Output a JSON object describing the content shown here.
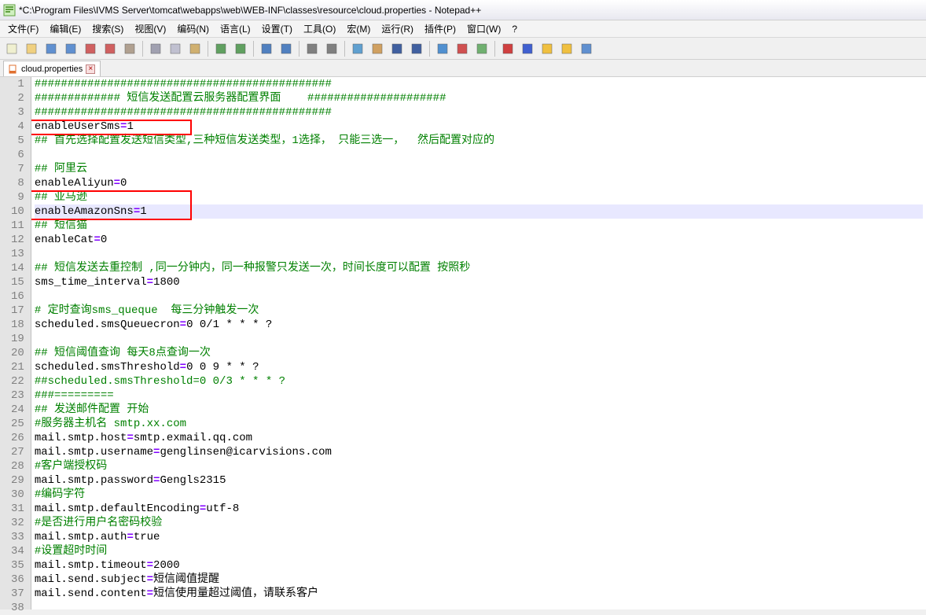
{
  "window": {
    "title": "*C:\\Program Files\\IVMS Server\\tomcat\\webapps\\web\\WEB-INF\\classes\\resource\\cloud.properties - Notepad++"
  },
  "menus": [
    {
      "label": "文件(F)"
    },
    {
      "label": "编辑(E)"
    },
    {
      "label": "搜索(S)"
    },
    {
      "label": "视图(V)"
    },
    {
      "label": "编码(N)"
    },
    {
      "label": "语言(L)"
    },
    {
      "label": "设置(T)"
    },
    {
      "label": "工具(O)"
    },
    {
      "label": "宏(M)"
    },
    {
      "label": "运行(R)"
    },
    {
      "label": "插件(P)"
    },
    {
      "label": "窗口(W)"
    },
    {
      "label": "?"
    }
  ],
  "tab": {
    "label": "cloud.properties",
    "close": "×"
  },
  "toolbar_icons": [
    "new-icon",
    "open-icon",
    "save-icon",
    "saveall-icon",
    "close-icon",
    "closeall-icon",
    "print-icon",
    "sep",
    "cut-icon",
    "copy-icon",
    "paste-icon",
    "sep",
    "undo-icon",
    "redo-icon",
    "sep",
    "find-icon",
    "replace-icon",
    "sep",
    "zoomin-icon",
    "zoomout-icon",
    "sep",
    "sync-icon",
    "wrap-icon",
    "allchars-icon",
    "indent-icon",
    "sep",
    "folder-icon",
    "lang-icon",
    "monitor-icon",
    "sep",
    "record-icon",
    "stoprec-icon",
    "play-icon",
    "playmulti-icon",
    "savemacro-icon"
  ],
  "lines": [
    {
      "n": 1,
      "t": "comment",
      "text": "#############################################"
    },
    {
      "n": 2,
      "t": "comment",
      "text": "############# 短信发送配置云服务器配置界面    #####################"
    },
    {
      "n": 3,
      "t": "comment",
      "text": "#############################################"
    },
    {
      "n": 4,
      "t": "kv",
      "key": "enableUserSms",
      "val": "1"
    },
    {
      "n": 5,
      "t": "comment",
      "text": "## 首先选择配置发送短信类型,三种短信发送类型，1选择， 只能三选一，  然后配置对应的"
    },
    {
      "n": 6,
      "t": "blank",
      "text": ""
    },
    {
      "n": 7,
      "t": "comment",
      "text": "## 阿里云"
    },
    {
      "n": 8,
      "t": "kv",
      "key": "enableAliyun",
      "val": "0"
    },
    {
      "n": 9,
      "t": "comment",
      "text": "## 亚马逊"
    },
    {
      "n": 10,
      "t": "kv",
      "key": "enableAmazonSns",
      "val": "1",
      "hl": true
    },
    {
      "n": 11,
      "t": "comment",
      "text": "## 短信猫"
    },
    {
      "n": 12,
      "t": "kv",
      "key": "enableCat",
      "val": "0"
    },
    {
      "n": 13,
      "t": "blank",
      "text": ""
    },
    {
      "n": 14,
      "t": "comment",
      "text": "## 短信发送去重控制 ,同一分钟内，同一种报警只发送一次，时间长度可以配置 按照秒"
    },
    {
      "n": 15,
      "t": "kv",
      "key": "sms_time_interval",
      "val": "1800"
    },
    {
      "n": 16,
      "t": "blank",
      "text": ""
    },
    {
      "n": 17,
      "t": "comment",
      "text": "# 定时查询sms_queque  每三分钟触发一次"
    },
    {
      "n": 18,
      "t": "kv",
      "key": "scheduled.smsQueuecron",
      "val": "0 0/1 * * * ?"
    },
    {
      "n": 19,
      "t": "blank",
      "text": ""
    },
    {
      "n": 20,
      "t": "comment",
      "text": "## 短信阈值查询 每天8点查询一次"
    },
    {
      "n": 21,
      "t": "kv",
      "key": "scheduled.smsThreshold",
      "val": "0 0 9 * * ?"
    },
    {
      "n": 22,
      "t": "comment",
      "text": "##scheduled.smsThreshold=0 0/3 * * * ?"
    },
    {
      "n": 23,
      "t": "comment",
      "text": "###========="
    },
    {
      "n": 24,
      "t": "comment",
      "text": "## 发送邮件配置 开始"
    },
    {
      "n": 25,
      "t": "comment",
      "text": "#服务器主机名 smtp.xx.com"
    },
    {
      "n": 26,
      "t": "kv",
      "key": "mail.smtp.host",
      "val": "smtp.exmail.qq.com"
    },
    {
      "n": 27,
      "t": "kv",
      "key": "mail.smtp.username",
      "val": "genglinsen@icarvisions.com"
    },
    {
      "n": 28,
      "t": "comment",
      "text": "#客户端授权码"
    },
    {
      "n": 29,
      "t": "kv",
      "key": "mail.smtp.password",
      "val": "Gengls2315"
    },
    {
      "n": 30,
      "t": "comment",
      "text": "#编码字符"
    },
    {
      "n": 31,
      "t": "kv",
      "key": "mail.smtp.defaultEncoding",
      "val": "utf-8"
    },
    {
      "n": 32,
      "t": "comment",
      "text": "#是否进行用户名密码校验"
    },
    {
      "n": 33,
      "t": "kv",
      "key": "mail.smtp.auth",
      "val": "true"
    },
    {
      "n": 34,
      "t": "comment",
      "text": "#设置超时时间"
    },
    {
      "n": 35,
      "t": "kv",
      "key": "mail.smtp.timeout",
      "val": "2000"
    },
    {
      "n": 36,
      "t": "kv",
      "key": "mail.send.subject",
      "val": "短信阈值提醒"
    },
    {
      "n": 37,
      "t": "kv",
      "key": "mail.send.content",
      "val": "短信使用量超过阈值，请联系客户"
    },
    {
      "n": 38,
      "t": "blank",
      "text": ""
    }
  ]
}
